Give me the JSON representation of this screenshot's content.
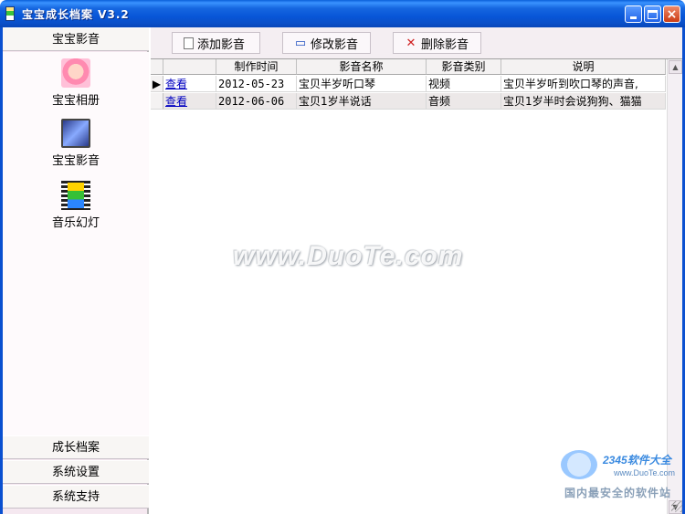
{
  "window": {
    "title": "宝宝成长档案 V3.2"
  },
  "sidebar": {
    "top_header": "宝宝影音",
    "items": [
      {
        "label": "宝宝相册",
        "icon": "photo-album-icon"
      },
      {
        "label": "宝宝影音",
        "icon": "media-player-icon"
      },
      {
        "label": "音乐幻灯",
        "icon": "film-strip-icon"
      }
    ],
    "bottom_headers": [
      "成长档案",
      "系统设置",
      "系统支持"
    ]
  },
  "toolbar": {
    "add_label": "添加影音",
    "edit_label": "修改影音",
    "delete_label": "删除影音"
  },
  "table": {
    "columns": [
      "",
      "制作时间",
      "影音名称",
      "影音类别",
      "说明"
    ],
    "rows": [
      {
        "view": "查看",
        "time": "2012-05-23",
        "name": "宝贝半岁听口琴",
        "type": "视频",
        "desc": "宝贝半岁听到吹口琴的声音,"
      },
      {
        "view": "查看",
        "time": "2012-06-06",
        "name": "宝贝1岁半说话",
        "type": "音频",
        "desc": "宝贝1岁半时会说狗狗、猫猫"
      }
    ]
  },
  "watermark": {
    "center": "www.DuoTe.com",
    "logo_brand": "2345软件大全",
    "logo_url": "www.DuoTe.com",
    "logo_slogan": "国内最安全的软件站"
  },
  "colors": {
    "titlebar": "#0a5fd8",
    "sidebar_bg": "#f5e8f0",
    "link": "#0000c0"
  }
}
